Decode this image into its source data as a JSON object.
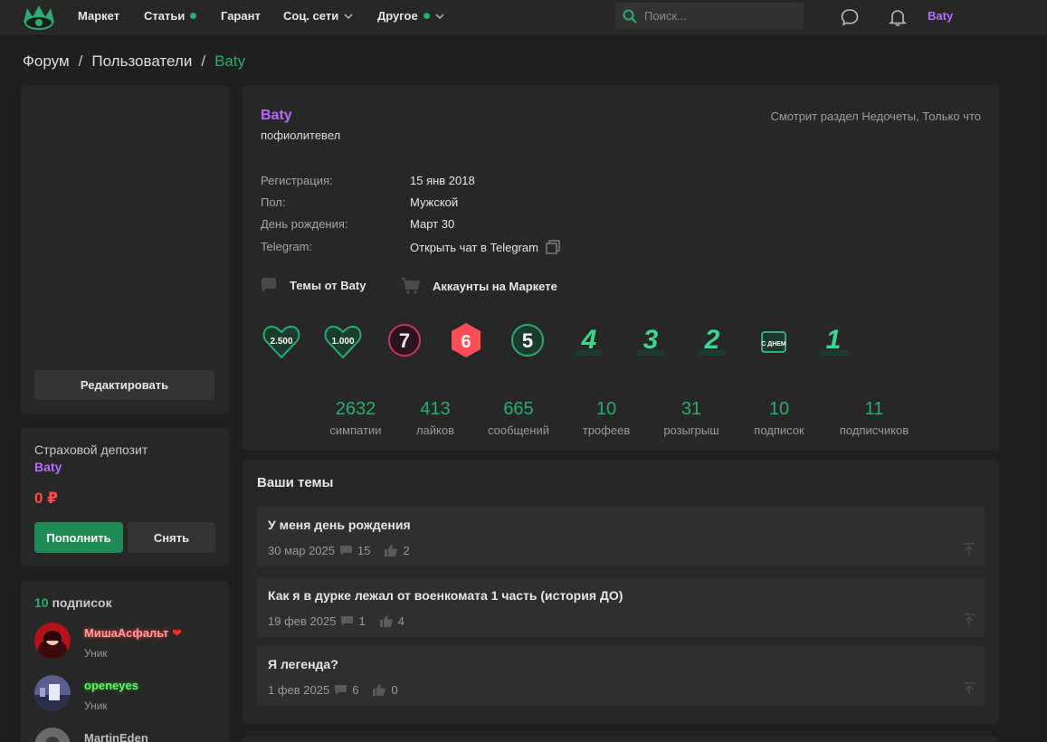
{
  "nav": {
    "items": [
      {
        "label": "Маркет"
      },
      {
        "label": "Статьи"
      },
      {
        "label": "Гарант"
      },
      {
        "label": "Соц. сети"
      },
      {
        "label": "Другое"
      }
    ],
    "search_placeholder": "Поиск...",
    "username": "Baty"
  },
  "breadcrumb": [
    "Форум",
    "Пользователи",
    "Baty"
  ],
  "sidebar": {
    "edit_label": "Редактировать",
    "deposit": {
      "title": "Страховой депозит",
      "user": "Baty",
      "amount": "0 ₽",
      "topup_label": "Пополнить",
      "withdraw_label": "Снять"
    },
    "subs": {
      "count": "10",
      "label": " подписок",
      "items": [
        {
          "name": "МишаАсфальт",
          "role": "Уник",
          "name_color": "#ff9c9c",
          "heart": "❤"
        },
        {
          "name": "openeyes",
          "role": "Уник",
          "name_color": "#6ef06e"
        },
        {
          "name": "MartinEden",
          "role": "",
          "name_color": "#bdbdbd"
        }
      ]
    }
  },
  "profile": {
    "name": "Baty",
    "status": "пофиолитевел",
    "activity": "Смотрит раздел Недочеты, Только что",
    "info": [
      {
        "label": "Регистрация:",
        "value": "15 янв 2018"
      },
      {
        "label": "Пол:",
        "value": "Мужской"
      },
      {
        "label": "День рождения:",
        "value": "Март 30"
      },
      {
        "label": "Telegram:",
        "value": "Открыть чат в Telegram"
      }
    ],
    "links": {
      "topics": "Темы от Baty",
      "market": "Аккаунты на Маркете"
    },
    "trophies": [
      {
        "text": "2.500",
        "color": "#2bad72"
      },
      {
        "text": "1.000",
        "color": "#2bad72"
      },
      {
        "text": "7",
        "color": "#d0306a"
      },
      {
        "text": "6",
        "color": "#ff4d5a"
      },
      {
        "text": "5",
        "color": "#2bad72"
      },
      {
        "text": "4",
        "color": "#3bd68f"
      },
      {
        "text": "3",
        "color": "#3bd68f"
      },
      {
        "text": "2",
        "color": "#3bd68f"
      },
      {
        "text": "С ДНЕМ",
        "color": "#3bd68f"
      },
      {
        "text": "1",
        "color": "#3bd68f"
      }
    ],
    "stats": [
      {
        "value": "2632",
        "label": "симпатии"
      },
      {
        "value": "413",
        "label": "лайков"
      },
      {
        "value": "665",
        "label": "сообщений"
      },
      {
        "value": "10",
        "label": "трофеев"
      },
      {
        "value": "31",
        "label": "розыгрыш"
      },
      {
        "value": "10",
        "label": "подписок"
      },
      {
        "value": "11",
        "label": "подписчиков"
      }
    ]
  },
  "topics": {
    "title": "Ваши темы",
    "items": [
      {
        "title": "У меня день рождения",
        "date": "30 мар 2025",
        "replies": "15",
        "likes": "2"
      },
      {
        "title": "Как я в дурке лежал от военкомата 1 часть (история ДО)",
        "date": "19 фев 2025",
        "replies": "1",
        "likes": "4"
      },
      {
        "title": "Я легенда?",
        "date": "1 фев 2025",
        "replies": "6",
        "likes": "0"
      }
    ]
  }
}
